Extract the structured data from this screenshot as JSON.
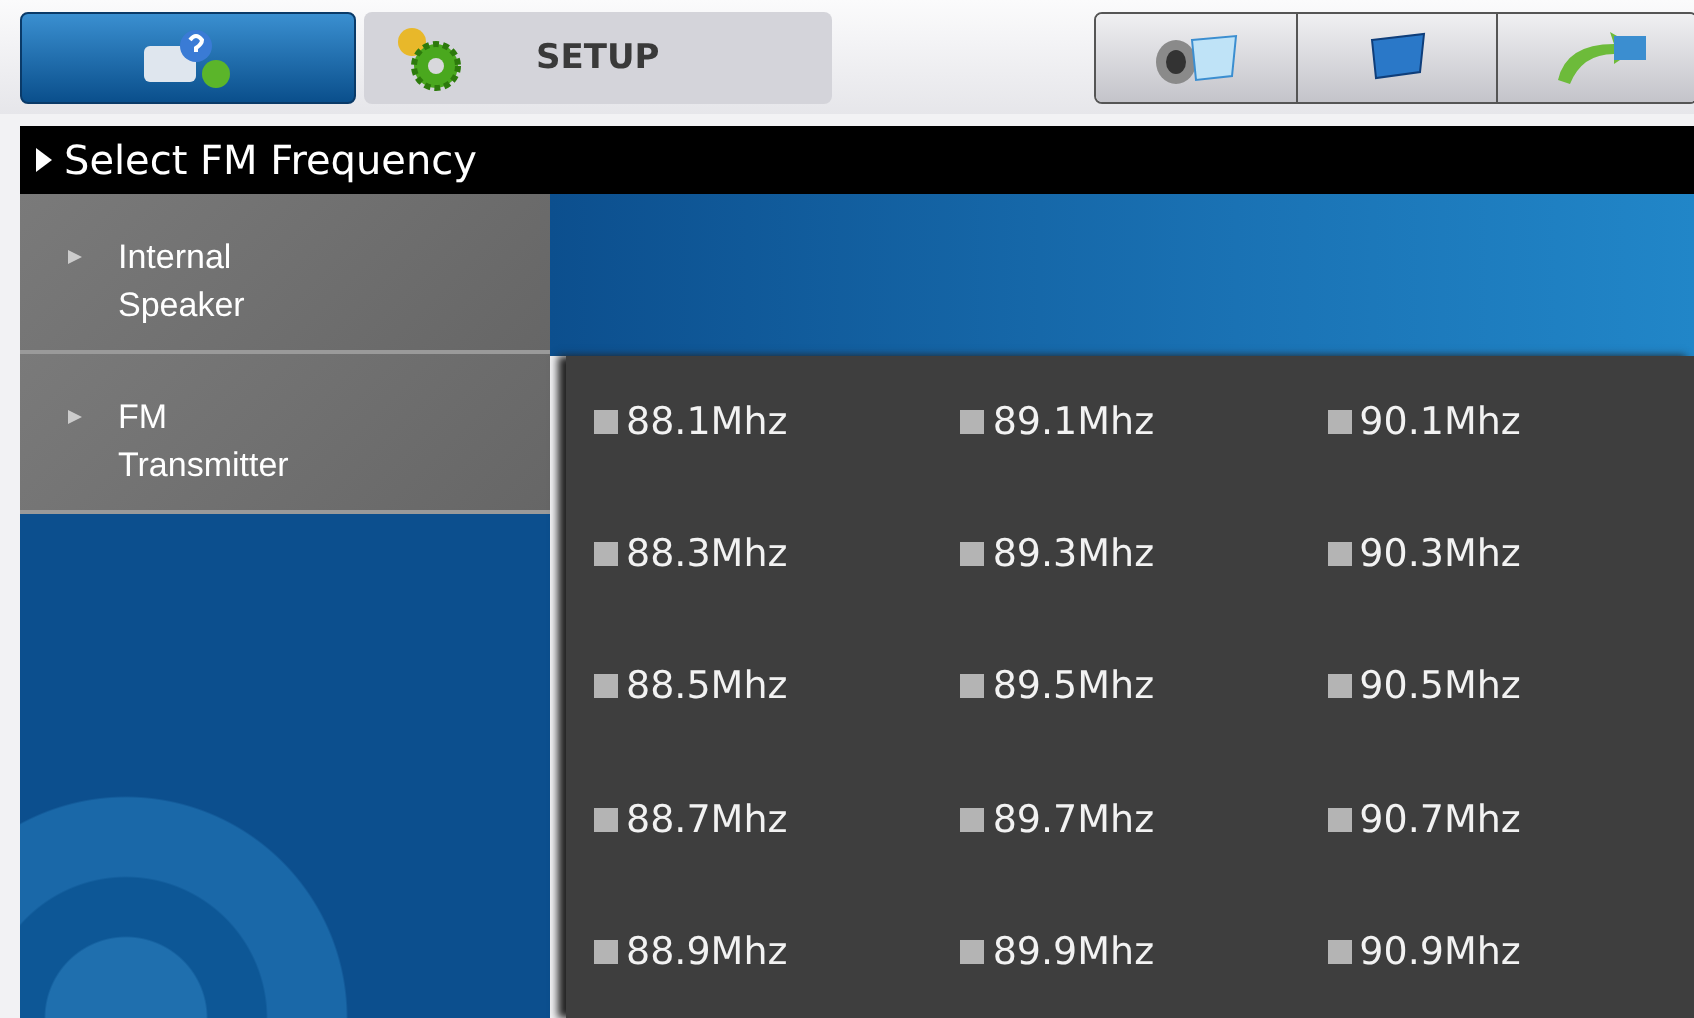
{
  "tabs": [
    {
      "kind": "icon",
      "selected": true
    },
    {
      "kind": "setup",
      "label": "SETUP",
      "selected": false
    }
  ],
  "toolbar": [
    {
      "kind": "speaker"
    },
    {
      "kind": "monitor"
    },
    {
      "kind": "arrow"
    }
  ],
  "header": {
    "title": "Select FM Frequency"
  },
  "sidebar": {
    "items": [
      {
        "label": "Internal\nSpeaker"
      },
      {
        "label": "FM\nTransmitter"
      }
    ]
  },
  "frequencies": [
    "88.1Mhz",
    "89.1Mhz",
    "90.1Mhz",
    "88.3Mhz",
    "89.3Mhz",
    "90.3Mhz",
    "88.5Mhz",
    "89.5Mhz",
    "90.5Mhz",
    "88.7Mhz",
    "89.7Mhz",
    "90.7Mhz",
    "88.9Mhz",
    "89.9Mhz",
    "90.9Mhz"
  ]
}
